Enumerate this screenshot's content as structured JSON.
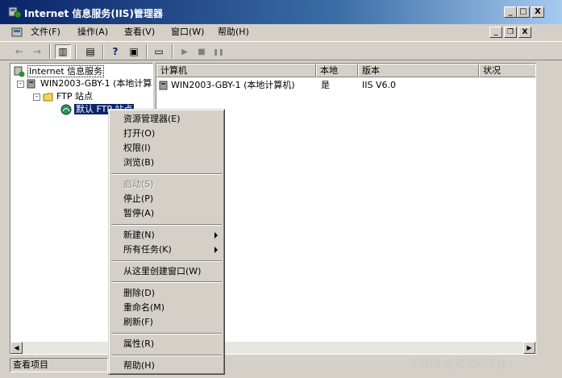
{
  "window": {
    "title": "Internet 信息服务(IIS)管理器",
    "controls": {
      "minimize": "_",
      "maximize": "□",
      "close": "X"
    }
  },
  "menubar": {
    "items": [
      {
        "label": "文件(F)"
      },
      {
        "label": "操作(A)"
      },
      {
        "label": "查看(V)"
      },
      {
        "label": "窗口(W)"
      },
      {
        "label": "帮助(H)"
      }
    ],
    "mdi_controls": {
      "minimize": "_",
      "restore": "❐",
      "close": "X"
    }
  },
  "toolbar": {
    "buttons": [
      {
        "icon": "back-arrow-icon",
        "glyph": "←"
      },
      {
        "icon": "forward-arrow-icon",
        "glyph": "→"
      },
      {
        "icon": "show-tree-icon",
        "glyph": "▥"
      },
      {
        "icon": "properties-icon",
        "glyph": "▤"
      },
      {
        "icon": "help-icon",
        "glyph": "?"
      },
      {
        "icon": "console-icon",
        "glyph": "▣"
      },
      {
        "icon": "computer-icon",
        "glyph": "▭"
      },
      {
        "icon": "play-icon",
        "glyph": "▶"
      },
      {
        "icon": "stop-icon",
        "glyph": "■"
      },
      {
        "icon": "pause-icon",
        "glyph": "❚❚"
      }
    ]
  },
  "tree": {
    "root": "Internet 信息服务",
    "computer": "WIN2003-GBY-1 (本地计算",
    "ftp_sites": "FTP 站点",
    "default_site": "默认 FTP 站点"
  },
  "list": {
    "columns": [
      "计算机",
      "本地",
      "版本",
      "状况"
    ],
    "rows": [
      {
        "computer": "WIN2003-GBY-1 (本地计算机)",
        "local": "是",
        "version": "IIS V6.0",
        "status": ""
      }
    ]
  },
  "context_menu": {
    "groups": [
      [
        {
          "label": "资源管理器(E)",
          "enabled": true,
          "submenu": false
        },
        {
          "label": "打开(O)",
          "enabled": true,
          "submenu": false
        },
        {
          "label": "权限(I)",
          "enabled": true,
          "submenu": false
        },
        {
          "label": "浏览(B)",
          "enabled": true,
          "submenu": false
        }
      ],
      [
        {
          "label": "启动(S)",
          "enabled": false,
          "submenu": false
        },
        {
          "label": "停止(P)",
          "enabled": true,
          "submenu": false
        },
        {
          "label": "暂停(A)",
          "enabled": true,
          "submenu": false
        }
      ],
      [
        {
          "label": "新建(N)",
          "enabled": true,
          "submenu": true
        },
        {
          "label": "所有任务(K)",
          "enabled": true,
          "submenu": true
        }
      ],
      [
        {
          "label": "从这里创建窗口(W)",
          "enabled": true,
          "submenu": false
        }
      ],
      [
        {
          "label": "删除(D)",
          "enabled": true,
          "submenu": false
        },
        {
          "label": "重命名(M)",
          "enabled": true,
          "submenu": false
        },
        {
          "label": "刷新(F)",
          "enabled": true,
          "submenu": false
        }
      ],
      [
        {
          "label": "属性(R)",
          "enabled": true,
          "submenu": false
        }
      ],
      [
        {
          "label": "帮助(H)",
          "enabled": true,
          "submenu": false
        }
      ]
    ]
  },
  "statusbar": {
    "text": "查看项目"
  },
  "watermark": "CSDN @可惜已不在",
  "colors": {
    "titlebar_start": "#0a246a",
    "titlebar_end": "#a6caf0",
    "face": "#d4d0c8",
    "selection": "#0a246a"
  }
}
